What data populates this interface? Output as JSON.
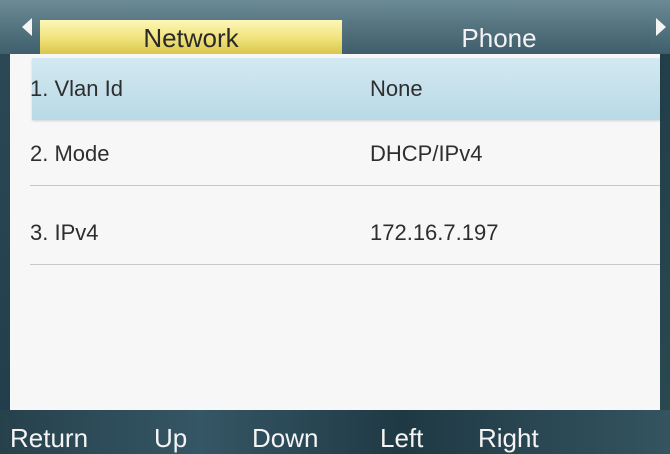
{
  "tabs": {
    "active": "Network",
    "inactive": "Phone"
  },
  "rows": [
    {
      "label": "1. Vlan Id",
      "value": "None"
    },
    {
      "label": "2. Mode",
      "value": "DHCP/IPv4"
    },
    {
      "label": "3. IPv4",
      "value": "172.16.7.197"
    }
  ],
  "softkeys": [
    "Return",
    "Up",
    "Down",
    "Left",
    "Right"
  ],
  "icons": {
    "tab_prev": "left-arrow-icon",
    "tab_next": "right-arrow-icon"
  },
  "colors": {
    "active_tab": "#f0e27a",
    "selected_row": "#b9d9e6",
    "panel_background": "#f7f7f7"
  }
}
